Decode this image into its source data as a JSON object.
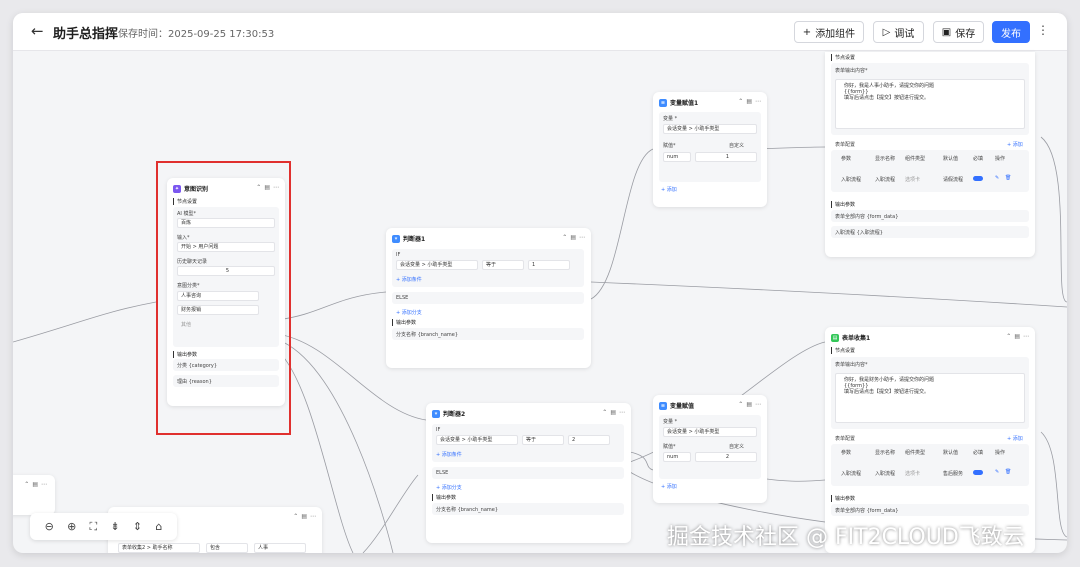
{
  "header": {
    "title": "助手总指挥",
    "save_time": "保存时间：2025-09-25 17:30:53",
    "add_component": "添加组件",
    "debug": "调试",
    "save": "保存",
    "publish": "发布"
  },
  "intent_node": {
    "title": "意图识别",
    "node_settings": "节点设置",
    "model_label": "AI 模型*",
    "model_value": "百炼",
    "input_label": "输入*",
    "input_value": "开始 > 用户问题",
    "history_label": "历史聊天记录",
    "history_value": "5",
    "classify_label": "意图分类*",
    "classes": [
      "人事咨询",
      "财务报销"
    ],
    "other": "其他",
    "output_params": "输出参数",
    "outputs": [
      "分类 {category}",
      "理由 {reason}"
    ]
  },
  "judge1": {
    "title": "判断器1",
    "if": "IF",
    "variable": "会话变量 > 小助手类型",
    "operator": "等于",
    "value": "1",
    "add_condition": "+ 添加条件",
    "else": "ELSE",
    "add_branch": "+ 添加分支",
    "output_params": "输出参数",
    "output": "分支名称 {branch_name}"
  },
  "judge2": {
    "title": "判断器2",
    "if": "IF",
    "variable": "会话变量 > 小助手类型",
    "operator": "等于",
    "value": "2",
    "add_condition": "+ 添加条件",
    "else": "ELSE",
    "add_branch": "+ 添加分支",
    "output_params": "输出参数",
    "output": "分支名称 {branch_name}"
  },
  "assign1": {
    "title": "变量赋值1",
    "variable_label": "变量 *",
    "variable_value": "会话变量 > 小助手类型",
    "assign_label": "赋值*",
    "mode": "自定义",
    "type": "num",
    "value": "1",
    "add": "+ 添加"
  },
  "assign2": {
    "title": "变量赋值",
    "variable_label": "变量 *",
    "variable_value": "会话变量 > 小助手类型",
    "assign_label": "赋值*",
    "mode": "自定义",
    "type": "num",
    "value": "2",
    "add": "+ 添加"
  },
  "form_top": {
    "node_settings": "节点设置",
    "output_content_label": "表单输出内容*",
    "content": [
      "你好，我是人事小助手，请提交你的问题",
      "{{form}}",
      "填写后请点击【提交】按钮进行提交。"
    ],
    "form_config": "表单配置",
    "add": "+ 添加",
    "columns": [
      "参数",
      "显示名称",
      "组件类型",
      "默认值",
      "必填",
      "操作"
    ],
    "row": [
      "入职流程",
      "入职流程",
      "选项卡",
      "请假流程"
    ],
    "output_params": "输出参数",
    "outputs": [
      "表单全部内容 {form_data}",
      "入职流程 {入职流程}"
    ]
  },
  "form_bottom": {
    "title": "表单收集1",
    "node_settings": "节点设置",
    "output_content_label": "表单输出内容*",
    "content": [
      "你好，我是财务小助手，请提交你的问题",
      "{{form}}",
      "填写后请点击【提交】按钮进行提交。"
    ],
    "form_config": "表单配置",
    "add": "+ 添加",
    "columns": [
      "参数",
      "显示名称",
      "组件类型",
      "默认值",
      "必填",
      "操作"
    ],
    "row": [
      "入职流程",
      "入职流程",
      "选项卡",
      "售后服务"
    ],
    "output_params": "输出参数",
    "outputs": [
      "表单全部内容 {form_data}"
    ]
  },
  "bottom_node": {
    "variable": "表单收集2 > 助手名称",
    "operator": "包含",
    "value": "人事"
  },
  "watermark": "掘金技术社区 @ FIT2CLOUD飞致云"
}
